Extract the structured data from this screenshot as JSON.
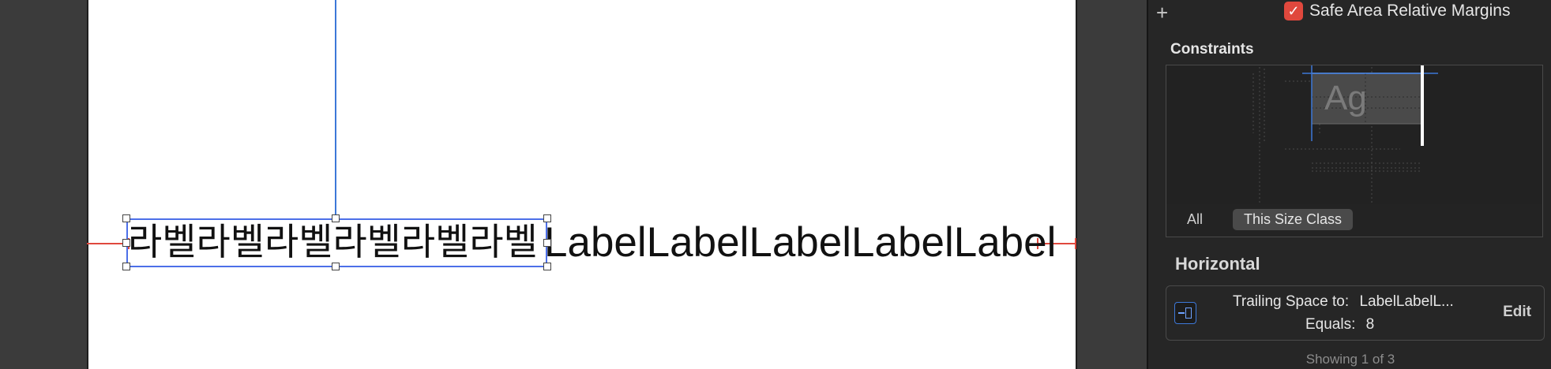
{
  "canvas": {
    "korean_label_text": "라벨라벨라벨라벨라벨라벨",
    "english_label_text": "LabelLabelLabelLabelLabel"
  },
  "inspector": {
    "add_symbol": "+",
    "safe_area_checked": true,
    "safe_area_label": "Safe Area Relative Margins",
    "constraints_title": "Constraints",
    "preview_glyph": "Ag",
    "tabs": {
      "all": "All",
      "size_class": "This Size Class"
    },
    "horizontal_title": "Horizontal",
    "constraint": {
      "attribute_label": "Trailing Space to:",
      "target": "LabelLabelL...",
      "equals_label": "Equals:",
      "equals_value": "8",
      "edit_label": "Edit"
    },
    "showing_text": "Showing 1 of 3"
  },
  "colors": {
    "constraint_red": "#e0483d",
    "selection_blue": "#4c6fe8",
    "guide_blue": "#3d78d8",
    "inspector_bg": "#262626",
    "canvas_bg": "#3b3b3b"
  }
}
